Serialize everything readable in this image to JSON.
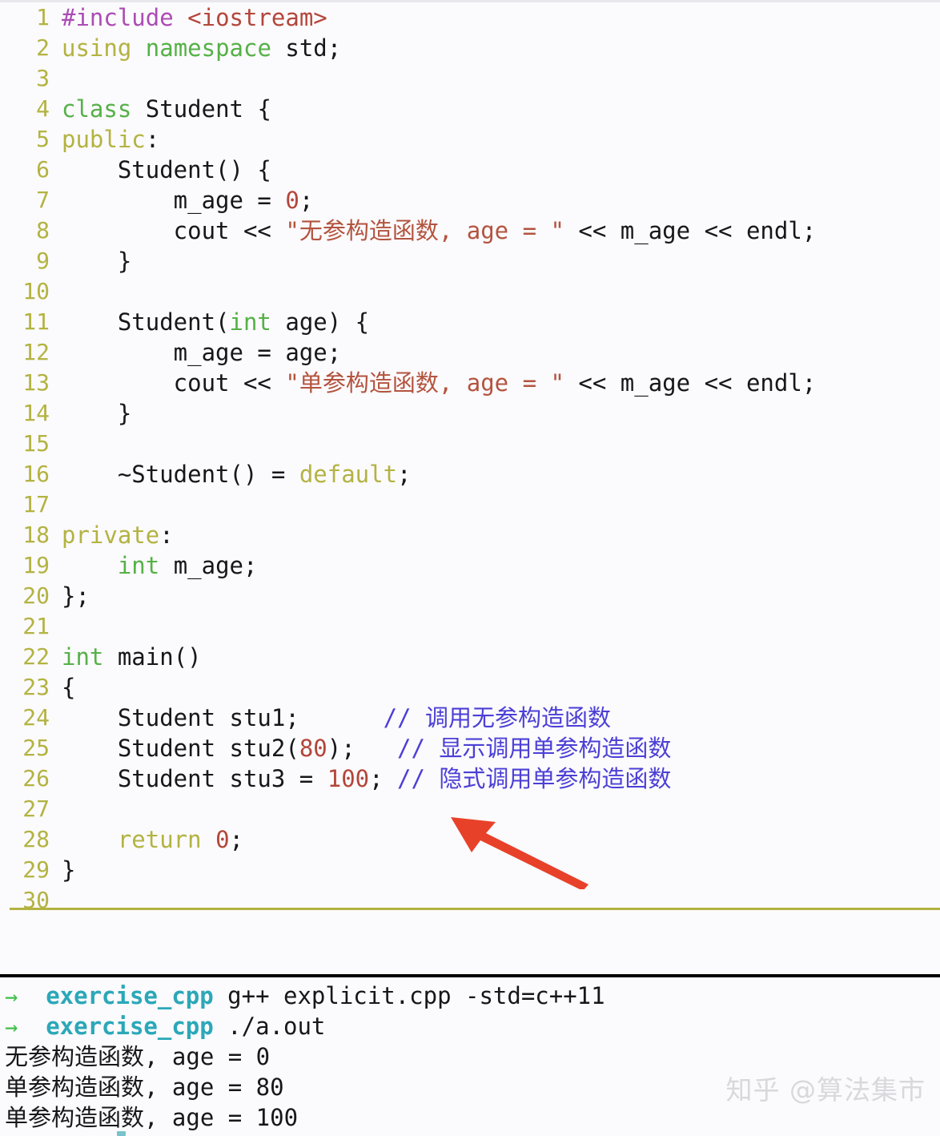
{
  "editor": {
    "language": "cpp",
    "total_lines": 30,
    "colors": {
      "background": "#fbfafc",
      "line_number": "#b3b342",
      "plain_text": "#17171b",
      "preprocessor": "#ab4cb4",
      "header": "#b3463a",
      "keyword": "#b3b342",
      "type": "#55b147",
      "string": "#b3543f",
      "number": "#b3463a",
      "comment": "#4b3fd6",
      "rule": "#b3b342"
    },
    "lines": [
      {
        "n": "1",
        "tokens": [
          {
            "t": "#include",
            "c": "tk-pre"
          },
          {
            "t": " ",
            "c": "tk-plain"
          },
          {
            "t": "<iostream>",
            "c": "tk-hdr"
          }
        ]
      },
      {
        "n": "2",
        "tokens": [
          {
            "t": "using",
            "c": "tk-kw"
          },
          {
            "t": " ",
            "c": "tk-plain"
          },
          {
            "t": "namespace",
            "c": "tk-type"
          },
          {
            "t": " std;",
            "c": "tk-plain"
          }
        ]
      },
      {
        "n": "3",
        "tokens": []
      },
      {
        "n": "4",
        "tokens": [
          {
            "t": "class",
            "c": "tk-type"
          },
          {
            "t": " Student {",
            "c": "tk-plain"
          }
        ]
      },
      {
        "n": "5",
        "tokens": [
          {
            "t": "public",
            "c": "tk-kw"
          },
          {
            "t": ":",
            "c": "tk-plain"
          }
        ]
      },
      {
        "n": "6",
        "tokens": [
          {
            "t": "    Student() {",
            "c": "tk-plain"
          }
        ]
      },
      {
        "n": "7",
        "tokens": [
          {
            "t": "        m_age = ",
            "c": "tk-plain"
          },
          {
            "t": "0",
            "c": "tk-num"
          },
          {
            "t": ";",
            "c": "tk-plain"
          }
        ]
      },
      {
        "n": "8",
        "tokens": [
          {
            "t": "        cout << ",
            "c": "tk-plain"
          },
          {
            "t": "\"无参构造函数, age = \"",
            "c": "tk-str"
          },
          {
            "t": " << m_age << endl;",
            "c": "tk-plain"
          }
        ]
      },
      {
        "n": "9",
        "tokens": [
          {
            "t": "    }",
            "c": "tk-plain"
          }
        ]
      },
      {
        "n": "10",
        "tokens": []
      },
      {
        "n": "11",
        "tokens": [
          {
            "t": "    Student(",
            "c": "tk-plain"
          },
          {
            "t": "int",
            "c": "tk-type"
          },
          {
            "t": " age) {",
            "c": "tk-plain"
          }
        ]
      },
      {
        "n": "12",
        "tokens": [
          {
            "t": "        m_age = age;",
            "c": "tk-plain"
          }
        ]
      },
      {
        "n": "13",
        "tokens": [
          {
            "t": "        cout << ",
            "c": "tk-plain"
          },
          {
            "t": "\"单参构造函数, age = \"",
            "c": "tk-str"
          },
          {
            "t": " << m_age << endl;",
            "c": "tk-plain"
          }
        ]
      },
      {
        "n": "14",
        "tokens": [
          {
            "t": "    }",
            "c": "tk-plain"
          }
        ]
      },
      {
        "n": "15",
        "tokens": []
      },
      {
        "n": "16",
        "tokens": [
          {
            "t": "    ~Student() = ",
            "c": "tk-plain"
          },
          {
            "t": "default",
            "c": "tk-kw"
          },
          {
            "t": ";",
            "c": "tk-plain"
          }
        ]
      },
      {
        "n": "17",
        "tokens": []
      },
      {
        "n": "18",
        "tokens": [
          {
            "t": "private",
            "c": "tk-kw"
          },
          {
            "t": ":",
            "c": "tk-plain"
          }
        ]
      },
      {
        "n": "19",
        "tokens": [
          {
            "t": "    ",
            "c": "tk-plain"
          },
          {
            "t": "int",
            "c": "tk-type"
          },
          {
            "t": " m_age;",
            "c": "tk-plain"
          }
        ]
      },
      {
        "n": "20",
        "tokens": [
          {
            "t": "};",
            "c": "tk-plain"
          }
        ]
      },
      {
        "n": "21",
        "tokens": []
      },
      {
        "n": "22",
        "tokens": [
          {
            "t": "int",
            "c": "tk-type"
          },
          {
            "t": " main()",
            "c": "tk-plain"
          }
        ]
      },
      {
        "n": "23",
        "tokens": [
          {
            "t": "{",
            "c": "tk-plain"
          }
        ]
      },
      {
        "n": "24",
        "tokens": [
          {
            "t": "    Student stu1;      ",
            "c": "tk-plain"
          },
          {
            "t": "// 调用无参构造函数",
            "c": "tk-cmt"
          }
        ]
      },
      {
        "n": "25",
        "tokens": [
          {
            "t": "    Student stu2(",
            "c": "tk-plain"
          },
          {
            "t": "80",
            "c": "tk-num"
          },
          {
            "t": ");   ",
            "c": "tk-plain"
          },
          {
            "t": "// 显示调用单参构造函数",
            "c": "tk-cmt"
          }
        ]
      },
      {
        "n": "26",
        "tokens": [
          {
            "t": "    Student stu3 = ",
            "c": "tk-plain"
          },
          {
            "t": "100",
            "c": "tk-num"
          },
          {
            "t": "; ",
            "c": "tk-plain"
          },
          {
            "t": "// 隐式调用单参构造函数",
            "c": "tk-cmt"
          }
        ]
      },
      {
        "n": "27",
        "tokens": []
      },
      {
        "n": "28",
        "tokens": [
          {
            "t": "    ",
            "c": "tk-plain"
          },
          {
            "t": "return",
            "c": "tk-kw"
          },
          {
            "t": " ",
            "c": "tk-plain"
          },
          {
            "t": "0",
            "c": "tk-num"
          },
          {
            "t": ";",
            "c": "tk-plain"
          }
        ]
      },
      {
        "n": "29",
        "tokens": [
          {
            "t": "}",
            "c": "tk-plain"
          }
        ]
      },
      {
        "n": "30",
        "tokens": []
      }
    ]
  },
  "annotation": {
    "type": "arrow",
    "color": "#e8412a",
    "points_to": "line-26",
    "description": "red arrow pointing at the implicit conversion line"
  },
  "terminal": {
    "prompt_symbol": "→",
    "prompt_dir": "exercise_cpp",
    "prompt_arrow_color": "#3fbf4a",
    "prompt_dir_color": "#2ba8b8",
    "lines": [
      {
        "kind": "prompt",
        "command": "g++ explicit.cpp -std=c++11"
      },
      {
        "kind": "prompt",
        "command": "./a.out"
      },
      {
        "kind": "output",
        "text": "无参构造函数, age = 0"
      },
      {
        "kind": "output",
        "text": "单参构造函数, age = 80"
      },
      {
        "kind": "output",
        "text": "单参构造函数, age = 100"
      }
    ]
  },
  "watermark": {
    "text": "知乎 @算法集市"
  }
}
